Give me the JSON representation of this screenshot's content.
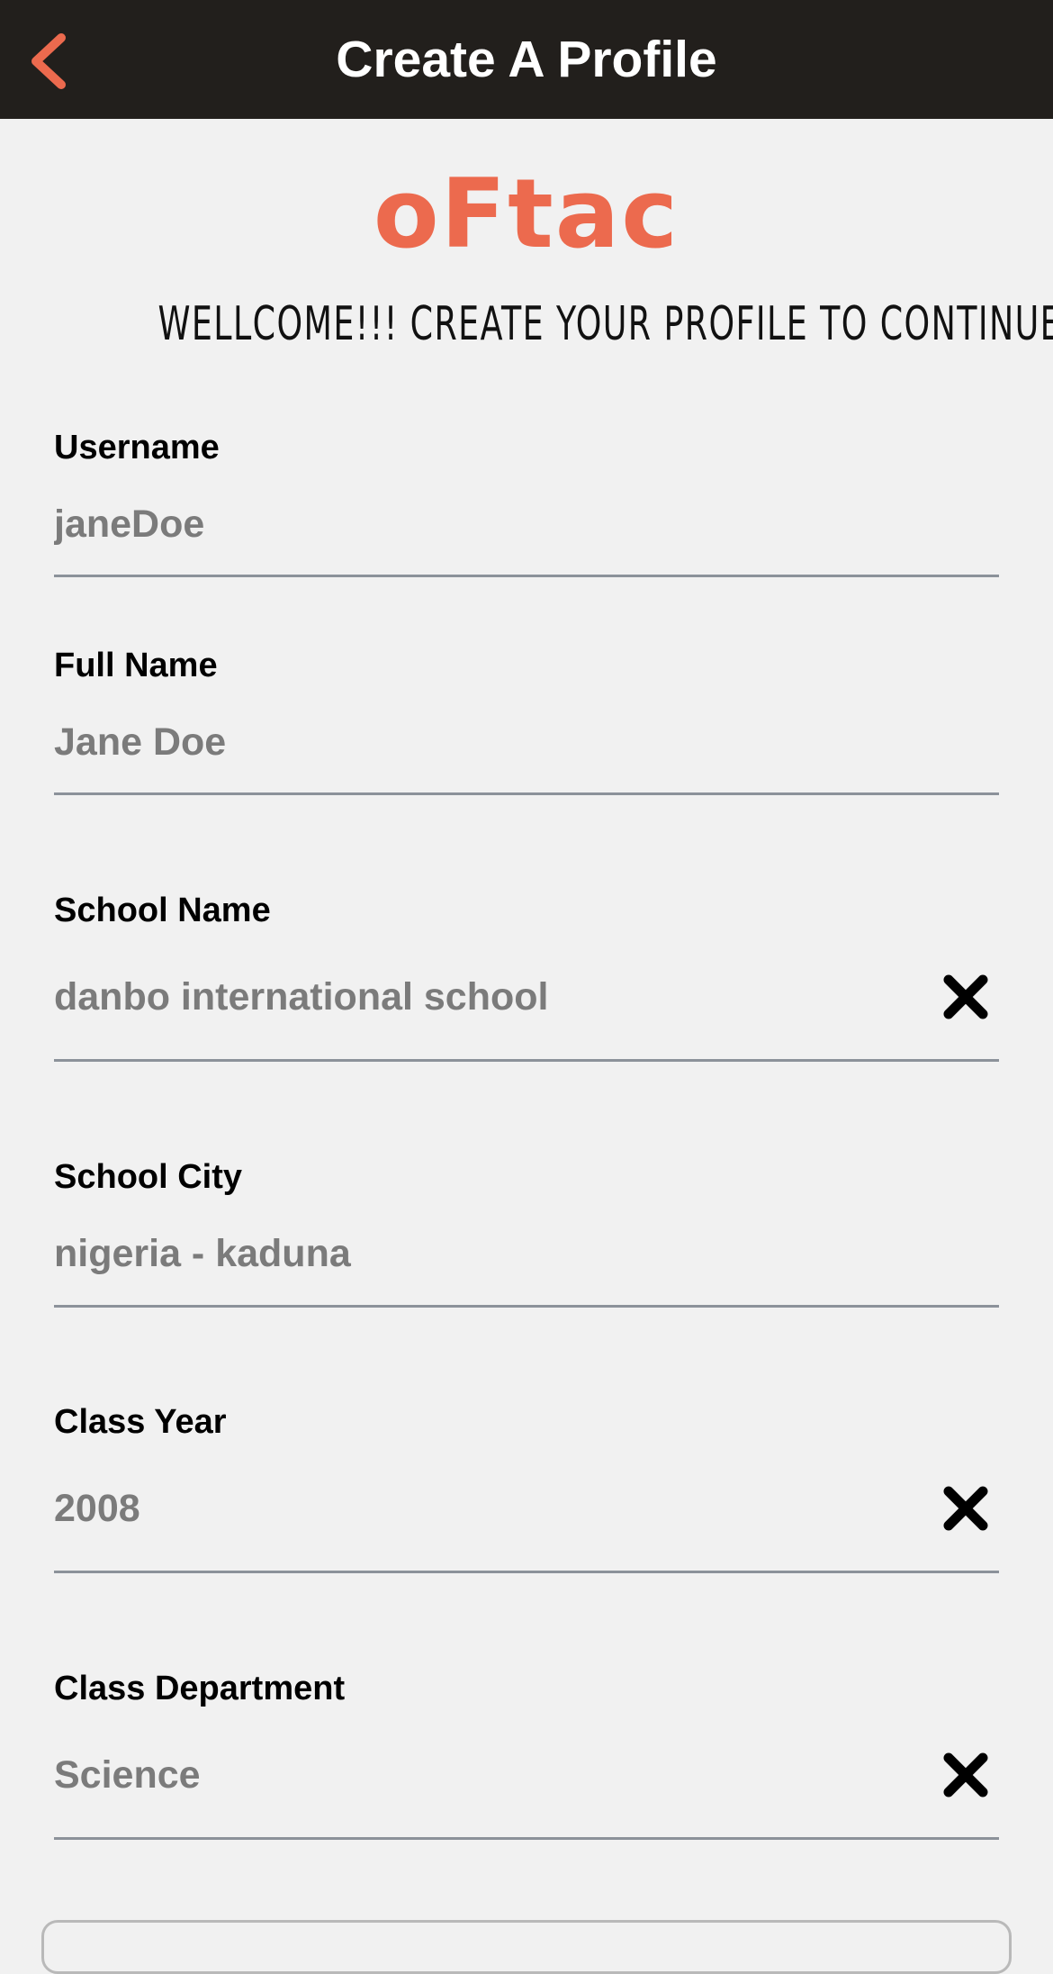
{
  "header": {
    "title": "Create A Profile",
    "back_icon": "chevron-left-icon",
    "accent_color": "#ec6a4e",
    "background": "#221f1c"
  },
  "logo": {
    "text": "oFtac",
    "color": "#ec6a4e"
  },
  "welcome": "WELLCOME!!! CREATE YOUR PROFILE TO CONTINUE",
  "fields": [
    {
      "label": "Username",
      "value": "janeDoe",
      "clear": false
    },
    {
      "label": "Full Name",
      "value": "Jane Doe",
      "clear": false
    },
    {
      "label": "School Name",
      "value": "danbo international school",
      "clear": true
    },
    {
      "label": "School City",
      "value": "nigeria - kaduna",
      "clear": false
    },
    {
      "label": "Class Year",
      "value": "2008",
      "clear": true
    },
    {
      "label": "Class Department",
      "value": "Science",
      "clear": true
    }
  ],
  "clear_icon": "close-icon"
}
